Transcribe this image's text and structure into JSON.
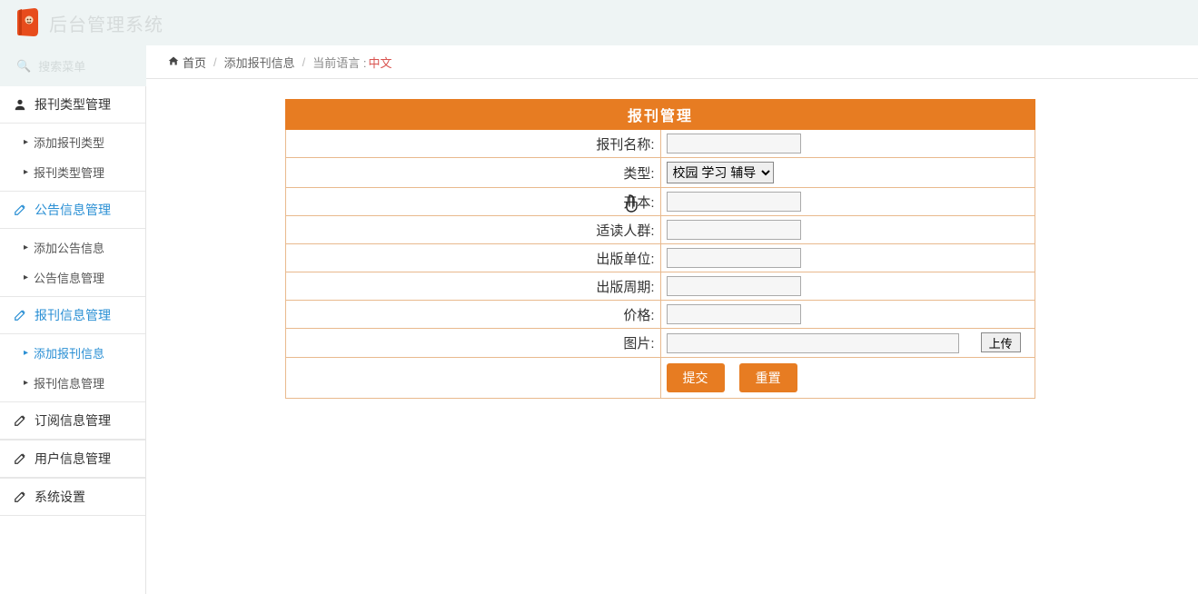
{
  "header": {
    "brand": "后台管理系统"
  },
  "sidebar_top": "搜索菜单",
  "breadcrumb": {
    "home": "首页",
    "current": "添加报刊信息",
    "lang_label": "当前语言 :",
    "lang_value": "中文"
  },
  "sidebar": {
    "groups": [
      {
        "icon": "user",
        "label": "报刊类型管理",
        "active": false,
        "items": [
          {
            "label": "添加报刊类型",
            "active": false
          },
          {
            "label": "报刊类型管理",
            "active": false
          }
        ]
      },
      {
        "icon": "edit",
        "label": "公告信息管理",
        "active": true,
        "items": [
          {
            "label": "添加公告信息",
            "active": false
          },
          {
            "label": "公告信息管理",
            "active": false
          }
        ]
      },
      {
        "icon": "edit",
        "label": "报刊信息管理",
        "active": true,
        "items": [
          {
            "label": "添加报刊信息",
            "active": true
          },
          {
            "label": "报刊信息管理",
            "active": false
          }
        ]
      },
      {
        "icon": "edit",
        "label": "订阅信息管理",
        "active": false,
        "items": []
      },
      {
        "icon": "edit",
        "label": "用户信息管理",
        "active": false,
        "items": []
      },
      {
        "icon": "edit",
        "label": "系统设置",
        "active": false,
        "items": []
      }
    ]
  },
  "form": {
    "title": "报刊管理",
    "rows": {
      "name_label": "报刊名称:",
      "type_label": "类型:",
      "type_value": "校园 学习 辅导",
      "format_label": "开本:",
      "audience_label": "适读人群:",
      "publisher_label": "出版单位:",
      "period_label": "出版周期:",
      "price_label": "价格:",
      "image_label": "图片:",
      "upload_btn": "上传",
      "submit_btn": "提交",
      "reset_btn": "重置"
    }
  }
}
